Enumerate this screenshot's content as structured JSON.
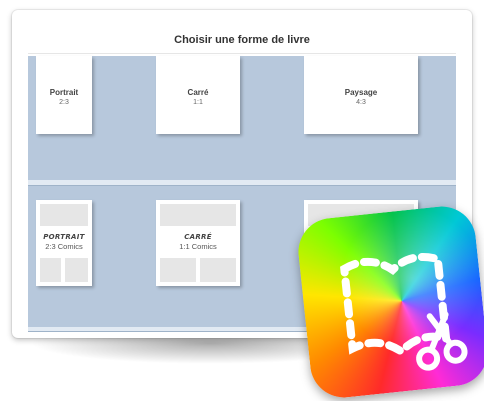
{
  "dialog": {
    "title": "Choisir une forme de livre"
  },
  "books": [
    {
      "name": "Portrait",
      "ratio": "2:3"
    },
    {
      "name": "Carré",
      "ratio": "1:1"
    },
    {
      "name": "Paysage",
      "ratio": "4:3"
    }
  ],
  "comics": [
    {
      "name": "PORTRAIT",
      "ratio": "2:3 Comics"
    },
    {
      "name": "CARRÉ",
      "ratio": "1:1 Comics"
    }
  ],
  "colors": {
    "shelf_background": "#b7c8dc",
    "shelf_ledge": "#e2eaf3",
    "panel_gray": "#e6e6e6"
  },
  "icons": {
    "app_icon": "book-creator-app-icon"
  }
}
